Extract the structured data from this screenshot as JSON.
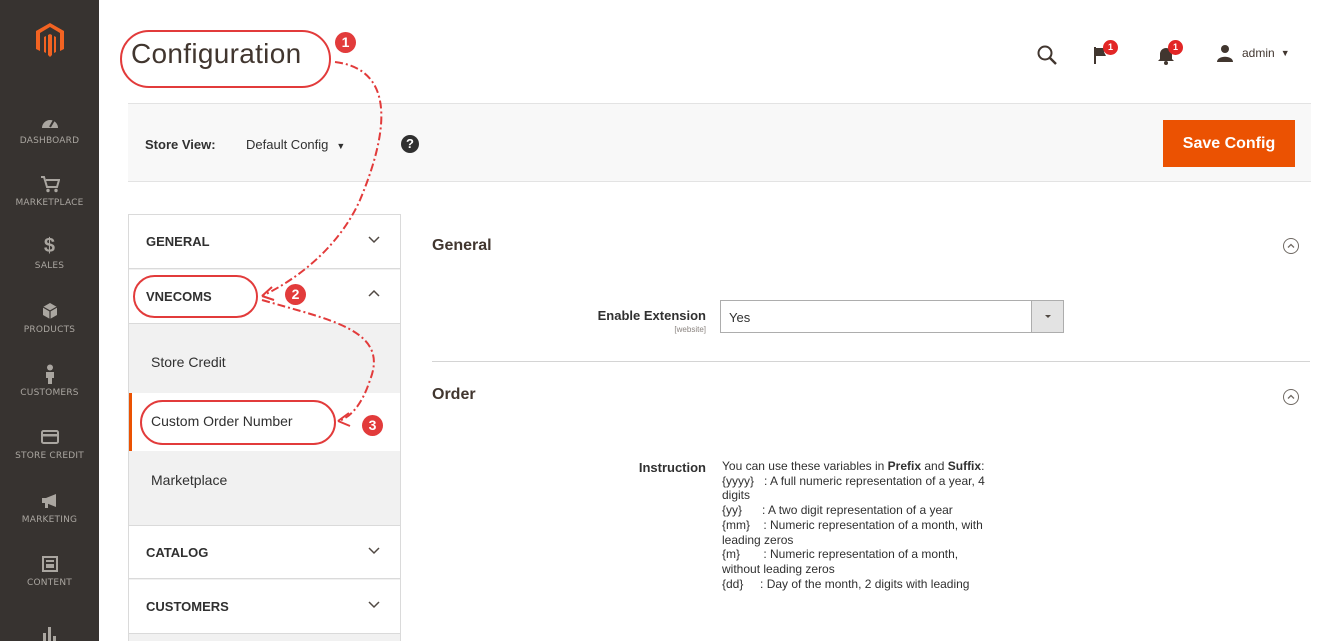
{
  "nav": {
    "items": [
      {
        "label": "DASHBOARD",
        "icon": "dashboard-icon"
      },
      {
        "label": "MARKETPLACE",
        "icon": "marketplace-icon"
      },
      {
        "label": "SALES",
        "icon": "dollar-icon"
      },
      {
        "label": "PRODUCTS",
        "icon": "box-icon"
      },
      {
        "label": "CUSTOMERS",
        "icon": "person-icon"
      },
      {
        "label": "STORE CREDIT",
        "icon": "card-icon"
      },
      {
        "label": "MARKETING",
        "icon": "megaphone-icon"
      },
      {
        "label": "CONTENT",
        "icon": "layout-icon"
      },
      {
        "label": "",
        "icon": "reports-icon"
      }
    ]
  },
  "header": {
    "title": "Configuration",
    "notifications_count": "1",
    "alerts_count": "1",
    "user": "admin"
  },
  "store_bar": {
    "label": "Store View:",
    "value": "Default Config",
    "save_label": "Save Config"
  },
  "tabs": {
    "general": "GENERAL",
    "vnecoms": "VNECOMS",
    "sub_items": [
      "Store Credit",
      "Custom Order Number",
      "Marketplace"
    ],
    "catalog": "CATALOG",
    "customers": "CUSTOMERS"
  },
  "content": {
    "general_title": "General",
    "enable_label": "Enable Extension",
    "enable_scope": "[website]",
    "enable_value": "Yes",
    "order_title": "Order",
    "instruction_label": "Instruction",
    "instruction_intro_pre": "You can use these variables in ",
    "instruction_prefix": "Prefix",
    "instruction_and": " and ",
    "instruction_suffix": "Suffix",
    "instruction_colon": ":",
    "instruction_lines": [
      "{yyyy}   : A full numeric representation of a year, 4",
      "digits",
      "{yy}      : A two digit representation of a year",
      "{mm}    : Numeric representation of a month, with",
      "leading zeros",
      "{m}       : Numeric representation of a month,",
      "without leading zeros",
      "{dd}     : Day of the month, 2 digits with leading"
    ]
  },
  "annotations": [
    "1",
    "2",
    "3"
  ],
  "colors": {
    "accent": "#eb5202",
    "nav_bg": "#373330",
    "annotation": "#e23b3b"
  }
}
